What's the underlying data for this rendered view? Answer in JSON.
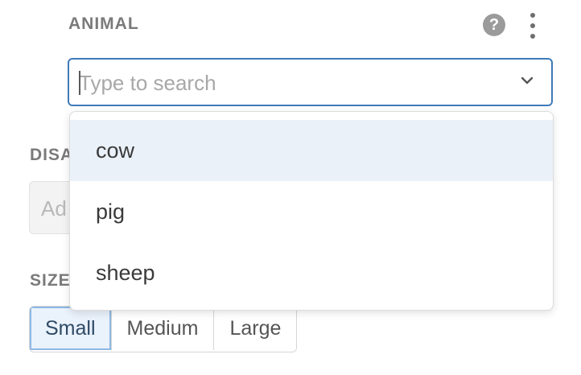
{
  "animal_field": {
    "label": "ANIMAL",
    "help_icon_glyph": "?",
    "search_placeholder": "Type to search",
    "search_value": ""
  },
  "dropdown": {
    "options": [
      {
        "label": "cow",
        "highlighted": true
      },
      {
        "label": "pig",
        "highlighted": false
      },
      {
        "label": "sheep",
        "highlighted": false
      }
    ]
  },
  "disabled_field": {
    "label_visible": "DISA",
    "placeholder_visible": "Ad"
  },
  "size_field": {
    "label_visible": "SIZE",
    "options": [
      "Small",
      "Medium",
      "Large"
    ],
    "selected": "Small"
  },
  "icons": {
    "help": "question-circle-icon",
    "more": "kebab-menu-icon",
    "expand": "chevron-down-icon"
  },
  "colors": {
    "accent": "#3f7ab8",
    "highlight": "#eaf1f8"
  }
}
